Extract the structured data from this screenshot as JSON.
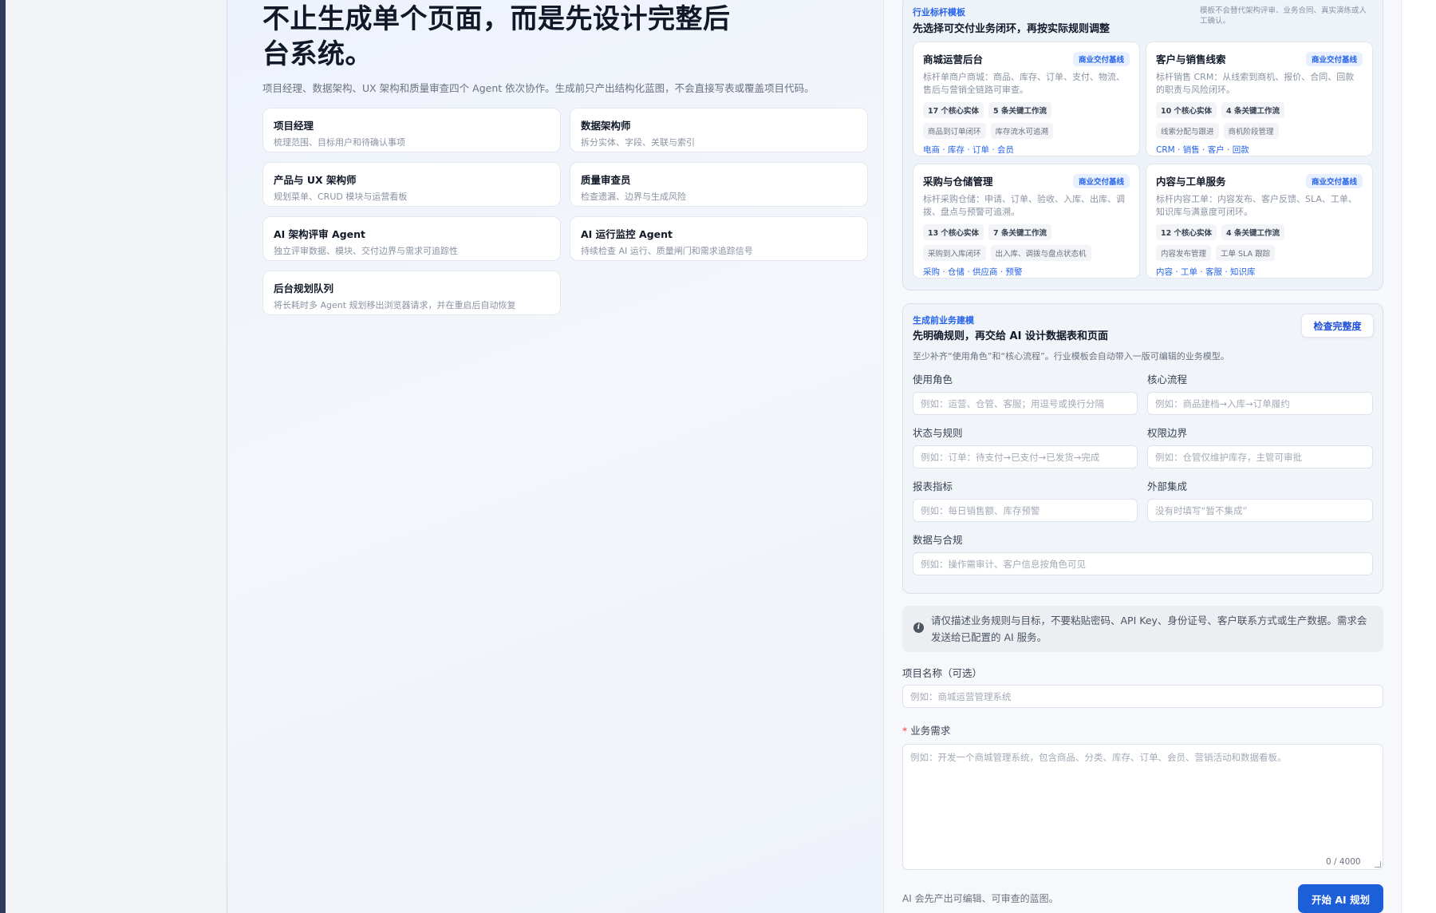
{
  "hero": {
    "title": "不止生成单个页面，而是先设计完整后台系统。",
    "subtitle": "项目经理、数据架构、UX 架构和质量审查四个 Agent 依次协作。生成前只产出结构化蓝图，不会直接写表或覆盖项目代码。"
  },
  "agents": [
    {
      "title": "项目经理",
      "desc": "梳理范围、目标用户和待确认事项"
    },
    {
      "title": "数据架构师",
      "desc": "拆分实体、字段、关联与索引"
    },
    {
      "title": "产品与 UX 架构师",
      "desc": "规划菜单、CRUD 模块与运营看板"
    },
    {
      "title": "质量审查员",
      "desc": "检查遗漏、边界与生成风险"
    },
    {
      "title": "AI 架构评审 Agent",
      "desc": "独立评审数据、模块、交付边界与需求可追踪性"
    },
    {
      "title": "AI 运行监控 Agent",
      "desc": "持续检查 AI 运行、质量闸门和需求追踪信号"
    },
    {
      "title": "后台规划队列",
      "desc": "将长耗时多 Agent 规划移出浏览器请求，并在重启后自动恢复"
    }
  ],
  "templates": {
    "eyebrow": "行业标杆模板",
    "title": "先选择可交付业务闭环，再按实际规则调整",
    "note": "模板不会替代架构评审、业务合同、真实演练或人工确认。",
    "cards": [
      {
        "name": "商城运营后台",
        "badge": "商业交付基线",
        "desc": "标杆单商户商城：商品、库存、订单、支付、物流、售后与营销全链路可审查。",
        "stats": [
          "17 个核心实体",
          "5 条关键工作流"
        ],
        "flows": [
          "商品到订单闭环",
          "库存流水可追溯"
        ],
        "tags": "电商 · 库存 · 订单 · 会员"
      },
      {
        "name": "客户与销售线索",
        "badge": "商业交付基线",
        "desc": "标杆销售 CRM：从线索到商机、报价、合同、回款的职责与风险闭环。",
        "stats": [
          "10 个核心实体",
          "4 条关键工作流"
        ],
        "flows": [
          "线索分配与跟进",
          "商机阶段管理"
        ],
        "tags": "CRM · 销售 · 客户 · 回款"
      },
      {
        "name": "采购与仓储管理",
        "badge": "商业交付基线",
        "desc": "标杆采购仓储：申请、订单、验收、入库、出库、调拨、盘点与预警可追溯。",
        "stats": [
          "13 个核心实体",
          "7 条关键工作流"
        ],
        "flows": [
          "采购到入库闭环",
          "出入库、调拨与盘点状态机"
        ],
        "tags": "采购 · 仓储 · 供应商 · 预警"
      },
      {
        "name": "内容与工单服务",
        "badge": "商业交付基线",
        "desc": "标杆内容工单：内容发布、客户反馈、SLA、工单、知识库与满意度可闭环。",
        "stats": [
          "12 个核心实体",
          "4 条关键工作流"
        ],
        "flows": [
          "内容发布管理",
          "工单 SLA 跟踪"
        ],
        "tags": "内容 · 工单 · 客服 · 知识库"
      }
    ]
  },
  "modeling": {
    "eyebrow": "生成前业务建模",
    "title": "先明确规则，再交给 AI 设计数据表和页面",
    "check_button": "检查完整度",
    "hint": "至少补齐“使用角色”和“核心流程”。行业模板会自动带入一版可编辑的业务模型。",
    "fields": {
      "roles": {
        "label": "使用角色",
        "placeholder": "例如：运营、仓管、客服；用逗号或换行分隔"
      },
      "flow": {
        "label": "核心流程",
        "placeholder": "例如：商品建档→入库→订单履约"
      },
      "states": {
        "label": "状态与规则",
        "placeholder": "例如：订单：待支付→已支付→已发货→完成"
      },
      "perm": {
        "label": "权限边界",
        "placeholder": "例如：仓管仅维护库存，主管可审批"
      },
      "report": {
        "label": "报表指标",
        "placeholder": "例如：每日销售额、库存预警"
      },
      "integration": {
        "label": "外部集成",
        "placeholder": "没有时填写“暂不集成”"
      },
      "compliance": {
        "label": "数据与合规",
        "placeholder": "例如：操作需审计、客户信息按角色可见"
      }
    }
  },
  "notice": {
    "icon": "info-icon",
    "text": "请仅描述业务规则与目标，不要粘贴密码、API Key、身份证号、客户联系方式或生产数据。需求会发送给已配置的 AI 服务。"
  },
  "project": {
    "name_label": "项目名称（可选）",
    "name_placeholder": "例如：商城运营管理系统",
    "req_star": "*",
    "req_label": "业务需求",
    "req_placeholder": "例如：开发一个商城管理系统，包含商品、分类、库存、订单、会员、营销活动和数据看板。",
    "counter": "0 / 4000"
  },
  "footer": {
    "note": "AI 会先产出可编辑、可审查的蓝图。",
    "start_button": "开始 AI 规划"
  },
  "colors": {
    "accent": "#2563eb",
    "primary_button": "#1d5fd8",
    "required": "#ef4444"
  }
}
